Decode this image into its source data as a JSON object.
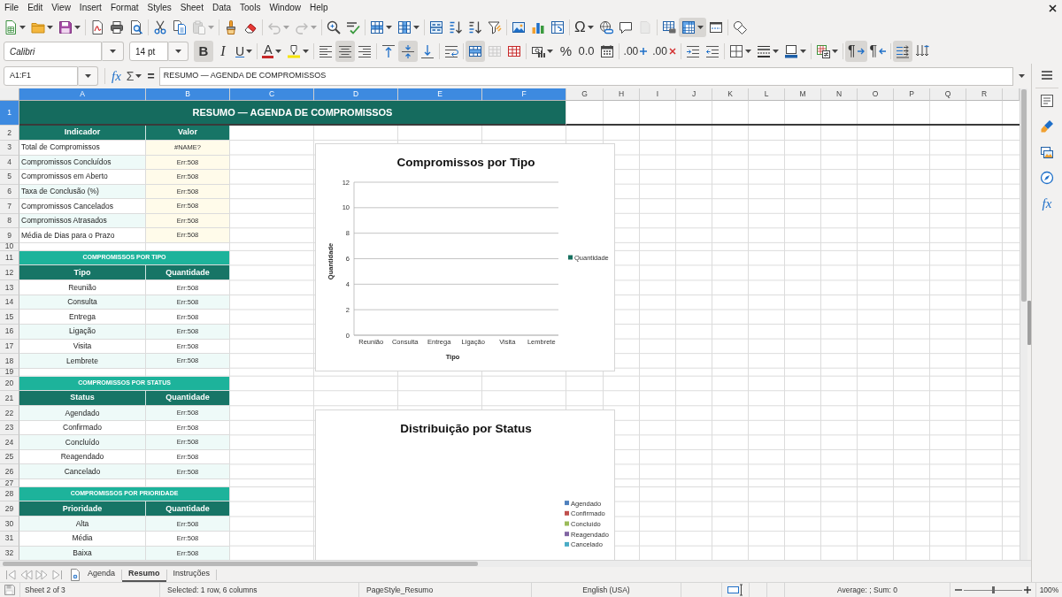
{
  "menu_bar": [
    "File",
    "Edit",
    "View",
    "Insert",
    "Format",
    "Styles",
    "Sheet",
    "Data",
    "Tools",
    "Window",
    "Help"
  ],
  "standard_toolbar": [
    [
      {
        "kind": "new",
        "dropdown": true,
        "pressed": false,
        "disabled": false
      },
      {
        "kind": "open",
        "dropdown": true,
        "pressed": false,
        "disabled": false
      },
      {
        "kind": "save",
        "dropdown": true,
        "pressed": false,
        "disabled": false
      }
    ],
    [
      {
        "kind": "export-pdf",
        "dropdown": false,
        "pressed": false,
        "disabled": false
      },
      {
        "kind": "print",
        "dropdown": false,
        "pressed": false,
        "disabled": false
      },
      {
        "kind": "print-preview",
        "dropdown": false,
        "pressed": false,
        "disabled": false
      }
    ],
    [
      {
        "kind": "cut",
        "dropdown": false,
        "pressed": false,
        "disabled": false
      },
      {
        "kind": "copy",
        "dropdown": false,
        "pressed": false,
        "disabled": false
      },
      {
        "kind": "paste",
        "dropdown": true,
        "pressed": false,
        "disabled": true
      }
    ],
    [
      {
        "kind": "clone-formatting",
        "dropdown": false,
        "pressed": false,
        "disabled": false
      },
      {
        "kind": "clear-formatting",
        "dropdown": false,
        "pressed": false,
        "disabled": false
      }
    ],
    [
      {
        "kind": "undo",
        "dropdown": true,
        "pressed": false,
        "disabled": true
      },
      {
        "kind": "redo",
        "dropdown": true,
        "pressed": false,
        "disabled": true
      }
    ],
    [
      {
        "kind": "find-replace",
        "dropdown": false,
        "pressed": false,
        "disabled": false
      },
      {
        "kind": "spelling",
        "dropdown": false,
        "pressed": false,
        "disabled": false
      }
    ],
    [
      {
        "kind": "rows",
        "dropdown": true,
        "pressed": false,
        "disabled": false
      },
      {
        "kind": "columns",
        "dropdown": true,
        "pressed": false,
        "disabled": false
      }
    ],
    [
      {
        "kind": "sort",
        "dropdown": false,
        "pressed": false,
        "disabled": false
      },
      {
        "kind": "sort-ascending",
        "dropdown": false,
        "pressed": false,
        "disabled": false
      },
      {
        "kind": "sort-descending",
        "dropdown": false,
        "pressed": false,
        "disabled": false
      },
      {
        "kind": "autofilter",
        "dropdown": false,
        "pressed": false,
        "disabled": false
      }
    ],
    [
      {
        "kind": "image",
        "dropdown": false,
        "pressed": false,
        "disabled": false
      },
      {
        "kind": "chart",
        "dropdown": false,
        "pressed": false,
        "disabled": false
      },
      {
        "kind": "pivot-table",
        "dropdown": false,
        "pressed": false,
        "disabled": false
      }
    ],
    [
      {
        "kind": "special-character",
        "glyph": "Ω",
        "dropdown": true,
        "pressed": false,
        "disabled": false
      },
      {
        "kind": "hyperlink",
        "dropdown": false,
        "pressed": false,
        "disabled": false
      },
      {
        "kind": "comment",
        "dropdown": false,
        "pressed": false,
        "disabled": false
      },
      {
        "kind": "header-footer",
        "dropdown": false,
        "pressed": false,
        "disabled": true
      }
    ],
    [
      {
        "kind": "print-area",
        "dropdown": false,
        "pressed": false,
        "disabled": false
      },
      {
        "kind": "freeze",
        "dropdown": true,
        "pressed": true,
        "disabled": false
      },
      {
        "kind": "split-window",
        "dropdown": false,
        "pressed": false,
        "disabled": false
      }
    ],
    [
      {
        "kind": "draw-functions",
        "dropdown": false,
        "pressed": false,
        "disabled": false
      }
    ]
  ],
  "formatting_toolbar": {
    "font_name": "Calibri",
    "font_size": "14 pt",
    "groups": [
      [
        {
          "kind": "bold",
          "glyph": "B",
          "dropdown": false,
          "pressed": true,
          "disabled": false
        },
        {
          "kind": "italic",
          "glyph": "I",
          "dropdown": false,
          "pressed": false,
          "disabled": false
        },
        {
          "kind": "underline",
          "glyph": "U",
          "dropdown": true,
          "pressed": false,
          "disabled": false
        }
      ],
      [
        {
          "kind": "font-color",
          "glyph": "A",
          "dropdown": true,
          "pressed": false,
          "disabled": false
        },
        {
          "kind": "highlight",
          "dropdown": true,
          "pressed": false,
          "disabled": false
        }
      ],
      [
        {
          "kind": "align-left",
          "dropdown": false,
          "pressed": false,
          "disabled": false
        },
        {
          "kind": "align-center",
          "dropdown": false,
          "pressed": true,
          "disabled": false
        },
        {
          "kind": "align-right",
          "dropdown": false,
          "pressed": false,
          "disabled": false
        }
      ],
      [
        {
          "kind": "align-top",
          "dropdown": false,
          "pressed": false,
          "disabled": false
        },
        {
          "kind": "align-middle",
          "dropdown": false,
          "pressed": true,
          "disabled": false
        },
        {
          "kind": "align-bottom",
          "dropdown": false,
          "pressed": false,
          "disabled": false
        }
      ],
      [
        {
          "kind": "wrap-text",
          "dropdown": false,
          "pressed": false,
          "disabled": false
        }
      ],
      [
        {
          "kind": "merge-center",
          "dropdown": false,
          "pressed": true,
          "disabled": false
        },
        {
          "kind": "merge-cells",
          "dropdown": false,
          "pressed": false,
          "disabled": true
        },
        {
          "kind": "unmerge",
          "dropdown": false,
          "pressed": false,
          "disabled": false
        }
      ],
      [
        {
          "kind": "currency",
          "dropdown": true,
          "pressed": false,
          "disabled": false
        },
        {
          "kind": "percent",
          "glyph": "%",
          "dropdown": false,
          "pressed": false,
          "disabled": false
        },
        {
          "kind": "number",
          "glyph": "0.0",
          "dropdown": false,
          "pressed": false,
          "disabled": false
        },
        {
          "kind": "date",
          "dropdown": false,
          "pressed": false,
          "disabled": false
        }
      ],
      [
        {
          "kind": "add-decimal",
          "glyph": ".00",
          "dropdown": false,
          "pressed": false,
          "disabled": false
        },
        {
          "kind": "delete-decimal",
          "glyph": ".00",
          "dropdown": false,
          "pressed": false,
          "disabled": false
        }
      ],
      [
        {
          "kind": "indent-increase",
          "dropdown": false,
          "pressed": false,
          "disabled": false
        },
        {
          "kind": "indent-decrease",
          "dropdown": false,
          "pressed": false,
          "disabled": false
        }
      ],
      [
        {
          "kind": "borders",
          "dropdown": true,
          "pressed": false,
          "disabled": false
        },
        {
          "kind": "border-style",
          "dropdown": true,
          "pressed": false,
          "disabled": false
        },
        {
          "kind": "border-color",
          "dropdown": true,
          "pressed": false,
          "disabled": false
        }
      ],
      [
        {
          "kind": "conditional",
          "dropdown": true,
          "pressed": false,
          "disabled": false
        }
      ],
      [
        {
          "kind": "ltr",
          "glyph": "¶",
          "dropdown": false,
          "pressed": true,
          "disabled": false
        },
        {
          "kind": "rtl",
          "glyph": "¶",
          "dropdown": false,
          "pressed": false,
          "disabled": false
        }
      ],
      [
        {
          "kind": "text-ltr",
          "dropdown": false,
          "pressed": true,
          "disabled": false
        },
        {
          "kind": "text-vertical",
          "dropdown": false,
          "pressed": false,
          "disabled": false
        }
      ]
    ]
  },
  "formula_bar": {
    "name_box": "A1:F1",
    "buttons": [
      {
        "kind": "function-wizard",
        "glyph": "fx",
        "dropdown": false
      },
      {
        "kind": "sum",
        "glyph": "Σ",
        "dropdown": true
      },
      {
        "kind": "formula",
        "glyph": "=",
        "dropdown": false
      }
    ],
    "content": "RESUMO — AGENDA DE COMPROMISSOS"
  },
  "sheet": {
    "columns": [
      {
        "label": "A",
        "selected": true
      },
      {
        "label": "B",
        "selected": true
      },
      {
        "label": "C",
        "selected": true
      },
      {
        "label": "D",
        "selected": true
      },
      {
        "label": "E",
        "selected": true
      },
      {
        "label": "F",
        "selected": true
      },
      {
        "label": "G",
        "selected": false
      },
      {
        "label": "H",
        "selected": false
      },
      {
        "label": "I",
        "selected": false
      },
      {
        "label": "J",
        "selected": false
      },
      {
        "label": "K",
        "selected": false
      },
      {
        "label": "L",
        "selected": false
      },
      {
        "label": "M",
        "selected": false
      },
      {
        "label": "N",
        "selected": false
      },
      {
        "label": "O",
        "selected": false
      },
      {
        "label": "P",
        "selected": false
      },
      {
        "label": "Q",
        "selected": false
      },
      {
        "label": "R",
        "selected": false
      }
    ],
    "rows": [
      {
        "number": "1",
        "selected": true,
        "kind": "title",
        "cells": [
          "RESUMO — AGENDA DE COMPROMISSOS"
        ]
      },
      {
        "number": "2",
        "selected": false,
        "kind": "header",
        "cells": [
          "Indicador",
          "Valor"
        ]
      },
      {
        "number": "3",
        "selected": false,
        "kind": "indicator",
        "shaded": false,
        "cells": [
          "Total de Compromissos",
          "#NAME?"
        ]
      },
      {
        "number": "4",
        "selected": false,
        "kind": "indicator",
        "shaded": true,
        "cells": [
          "Compromissos Concluídos",
          "Err:508"
        ]
      },
      {
        "number": "5",
        "selected": false,
        "kind": "indicator",
        "shaded": false,
        "cells": [
          "Compromissos em Aberto",
          "Err:508"
        ]
      },
      {
        "number": "6",
        "selected": false,
        "kind": "indicator",
        "shaded": true,
        "cells": [
          "Taxa de Conclusão (%)",
          "Err:508"
        ]
      },
      {
        "number": "7",
        "selected": false,
        "kind": "indicator",
        "shaded": false,
        "cells": [
          "Compromissos Cancelados",
          "Err:508"
        ]
      },
      {
        "number": "8",
        "selected": false,
        "kind": "indicator",
        "shaded": true,
        "cells": [
          "Compromissos Atrasados",
          "Err:508"
        ]
      },
      {
        "number": "9",
        "selected": false,
        "kind": "indicator",
        "shaded": false,
        "cells": [
          "Média de Dias para o Prazo",
          "Err:508"
        ]
      },
      {
        "number": "10",
        "selected": false,
        "kind": "blank"
      },
      {
        "number": "11",
        "selected": false,
        "kind": "section",
        "cells": [
          "COMPROMISSOS POR TIPO"
        ]
      },
      {
        "number": "12",
        "selected": false,
        "kind": "header",
        "cells": [
          "Tipo",
          "Quantidade"
        ]
      },
      {
        "number": "13",
        "selected": false,
        "kind": "item",
        "shaded": false,
        "cells": [
          "Reunião",
          "Err:508"
        ]
      },
      {
        "number": "14",
        "selected": false,
        "kind": "item",
        "shaded": true,
        "cells": [
          "Consulta",
          "Err:508"
        ]
      },
      {
        "number": "15",
        "selected": false,
        "kind": "item",
        "shaded": false,
        "cells": [
          "Entrega",
          "Err:508"
        ]
      },
      {
        "number": "16",
        "selected": false,
        "kind": "item",
        "shaded": true,
        "cells": [
          "Ligação",
          "Err:508"
        ]
      },
      {
        "number": "17",
        "selected": false,
        "kind": "item",
        "shaded": false,
        "cells": [
          "Visita",
          "Err:508"
        ]
      },
      {
        "number": "18",
        "selected": false,
        "kind": "item",
        "shaded": true,
        "cells": [
          "Lembrete",
          "Err:508"
        ]
      },
      {
        "number": "19",
        "selected": false,
        "kind": "blank"
      },
      {
        "number": "20",
        "selected": false,
        "kind": "section",
        "cells": [
          "COMPROMISSOS POR STATUS"
        ]
      },
      {
        "number": "21",
        "selected": false,
        "kind": "header",
        "cells": [
          "Status",
          "Quantidade"
        ]
      },
      {
        "number": "22",
        "selected": false,
        "kind": "item",
        "shaded": true,
        "cells": [
          "Agendado",
          "Err:508"
        ]
      },
      {
        "number": "23",
        "selected": false,
        "kind": "item",
        "shaded": false,
        "cells": [
          "Confirmado",
          "Err:508"
        ]
      },
      {
        "number": "24",
        "selected": false,
        "kind": "item",
        "shaded": true,
        "cells": [
          "Concluído",
          "Err:508"
        ]
      },
      {
        "number": "25",
        "selected": false,
        "kind": "item",
        "shaded": false,
        "cells": [
          "Reagendado",
          "Err:508"
        ]
      },
      {
        "number": "26",
        "selected": false,
        "kind": "item",
        "shaded": true,
        "cells": [
          "Cancelado",
          "Err:508"
        ]
      },
      {
        "number": "27",
        "selected": false,
        "kind": "blank"
      },
      {
        "number": "28",
        "selected": false,
        "kind": "section",
        "cells": [
          "COMPROMISSOS POR PRIORIDADE"
        ]
      },
      {
        "number": "29",
        "selected": false,
        "kind": "header",
        "cells": [
          "Prioridade",
          "Quantidade"
        ]
      },
      {
        "number": "30",
        "selected": false,
        "kind": "item",
        "shaded": true,
        "cells": [
          "Alta",
          "Err:508"
        ]
      },
      {
        "number": "31",
        "selected": false,
        "kind": "item",
        "shaded": false,
        "cells": [
          "Média",
          "Err:508"
        ]
      },
      {
        "number": "32",
        "selected": false,
        "kind": "item",
        "shaded": true,
        "cells": [
          "Baixa",
          "Err:508"
        ]
      }
    ],
    "charts": [
      {
        "chart_data": {
          "type": "bar",
          "title": "Compromissos por Tipo",
          "xlabel": "Tipo",
          "ylabel": "Quantidade",
          "categories": [
            "Reunião",
            "Consulta",
            "Entrega",
            "Ligação",
            "Visita",
            "Lembrete"
          ],
          "series": [
            {
              "name": "Quantidade",
              "color": "#17705f",
              "values": [
                null,
                null,
                null,
                null,
                null,
                null
              ]
            }
          ],
          "ylim": [
            0,
            12
          ],
          "yticks": [
            0,
            2,
            4,
            6,
            8,
            10,
            12
          ],
          "grid": true
        }
      },
      {
        "title": "Distribuição por Status",
        "legend": [
          {
            "label": "Agendado",
            "color": "#4f81bd"
          },
          {
            "label": "Confirmado",
            "color": "#c0504d"
          },
          {
            "label": "Concluído",
            "color": "#9bbb59"
          },
          {
            "label": "Reagendado",
            "color": "#8064a2"
          },
          {
            "label": "Cancelado",
            "color": "#4bacc6"
          }
        ]
      }
    ]
  },
  "sheet_tabs": [
    {
      "label": "Agenda",
      "selected": false
    },
    {
      "label": "Resumo",
      "selected": true
    },
    {
      "label": "Instruções",
      "selected": false
    }
  ],
  "status_bar": {
    "sheet": "Sheet 2 of 3",
    "selection": "Selected: 1 row, 6 columns",
    "page_style": "PageStyle_Resumo",
    "language": "English (USA)",
    "summary": "Average: ; Sum: 0",
    "zoom": {
      "level": 0.5,
      "label": "100%"
    }
  },
  "sidebar": [
    {
      "kind": "properties"
    },
    {
      "kind": "styles"
    },
    {
      "kind": "gallery"
    },
    {
      "kind": "navigator"
    },
    {
      "kind": "functions",
      "glyph": "fx"
    }
  ]
}
